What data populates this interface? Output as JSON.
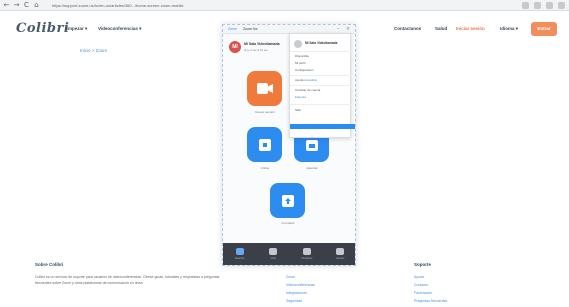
{
  "browser": {
    "back": "←",
    "forward": "→",
    "reload": "C",
    "home": "⌂",
    "url": "https://support.zoom.us/hc/en-us/articles/360.../home-screen-zoom-mobile"
  },
  "header": {
    "logo": "Colibri",
    "menu": [
      "Empezar ▾",
      "Videoconferencias ▾"
    ],
    "right_menu": [
      "Contactanos",
      "Salud",
      "Iniciar sesión",
      "Idioma ▾"
    ],
    "signup": "Entrar"
  },
  "breadcrumb": "Inicio > Zoom",
  "phone": {
    "tab": "Zoom",
    "title": "Zoom Inc",
    "profile": {
      "initials": "MI",
      "name": "Mi Sala Videollamada",
      "subtitle": "Hoy a las 9:41 am"
    },
    "apps": [
      {
        "label": "Nueva reunión"
      },
      {
        "label": "Unirse"
      },
      {
        "label": "Agendar"
      },
      {
        "label": "Compartir"
      }
    ],
    "nav": [
      "Reunión",
      "Chat",
      "Contactos",
      "Ajustes"
    ]
  },
  "dropdown": {
    "name": "Mi Sala Videollamada",
    "items": [
      "Disponible",
      "Mi perfil",
      "Configuración",
      "Ayuda",
      "Cambiar de cuenta",
      "Salir"
    ],
    "tagged": [
      "Actualizar",
      "Etiqueta"
    ]
  },
  "footer": {
    "about_heading": "Sobre Colibri",
    "about_text": "Colibri es un servicio de soporte para usuarios de videoconferencias. Ofrece guías, tutoriales y respuestas a preguntas frecuentes sobre Zoom y otras plataformas de comunicación en línea.",
    "col2_links": [
      "Zoom",
      "Videoconferencias",
      "Integraciones",
      "Seguridad"
    ],
    "col3_heading": "Soporte",
    "col3_links": [
      "Ayuda",
      "Contacto",
      "Facturación",
      "Preguntas frecuentes"
    ]
  }
}
